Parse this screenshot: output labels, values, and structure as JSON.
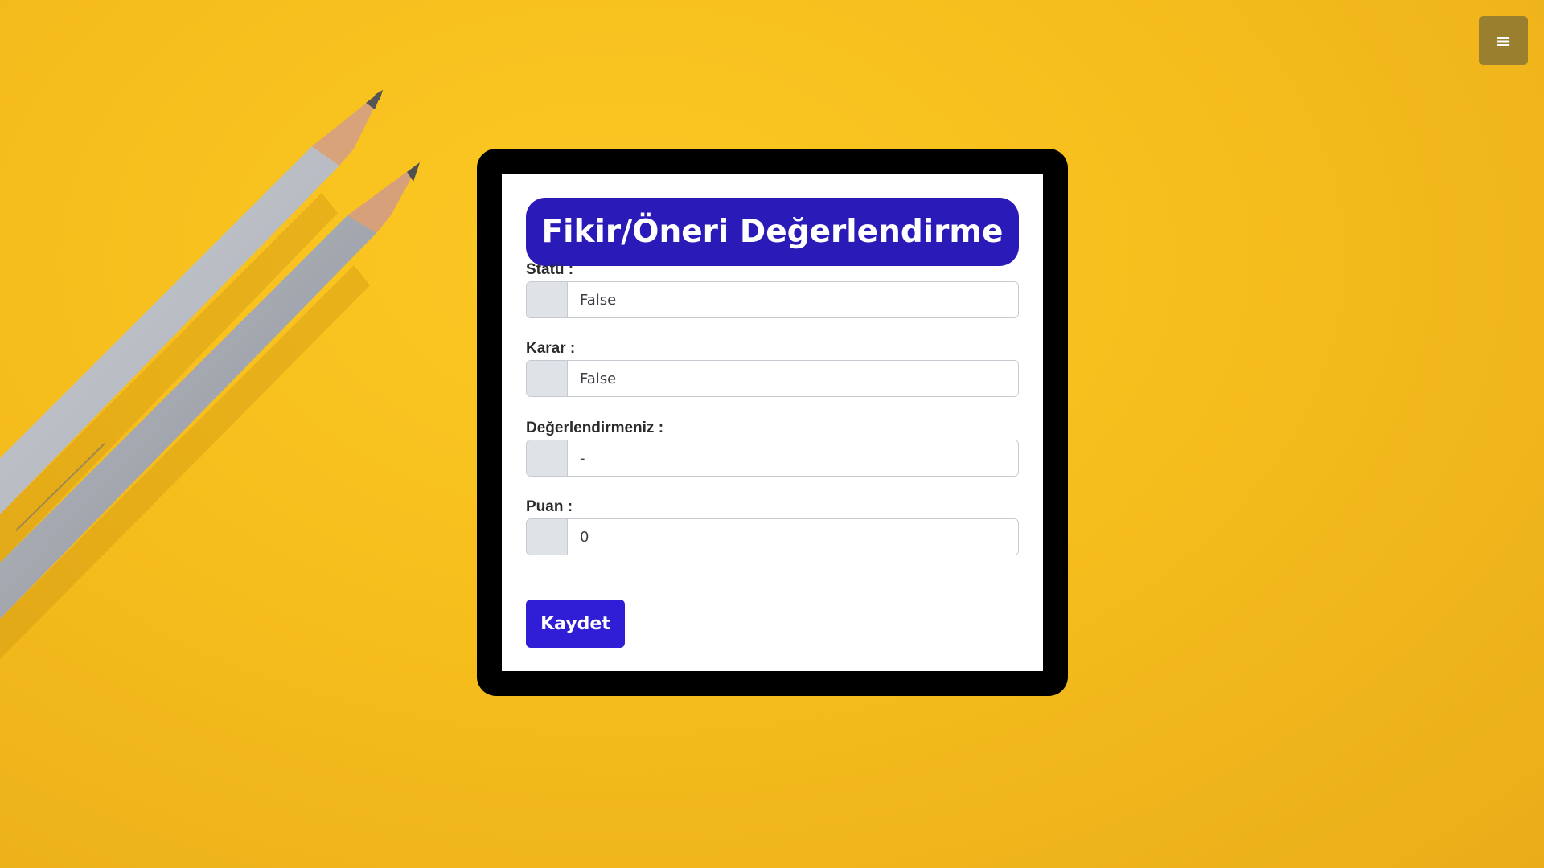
{
  "menu": {
    "icon": "menu-icon",
    "glyph": "≡"
  },
  "form": {
    "title": "Fikir/Öneri Değerlendirme",
    "fields": [
      {
        "label": "Statü :",
        "value": "False"
      },
      {
        "label": "Karar :",
        "value": "False"
      },
      {
        "label": "Değerlendirmeniz :",
        "value": "-"
      },
      {
        "label": "Puan :",
        "value": "0"
      }
    ],
    "save_label": "Kaydet"
  },
  "colors": {
    "background": "#f6be1c",
    "frame": "#000000",
    "title_bg": "#2a1bb8",
    "button_bg": "#2f1ed6",
    "menu_bg": "#9a7f2e",
    "addon_bg": "#dfe2e6"
  }
}
